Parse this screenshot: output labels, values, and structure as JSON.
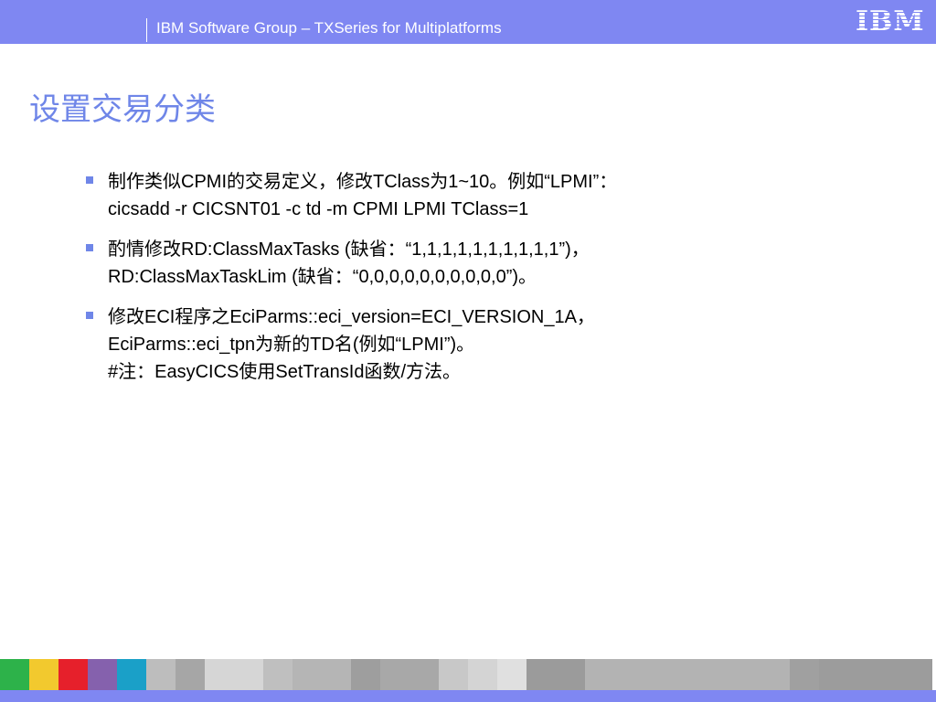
{
  "header": {
    "title": "IBM Software Group – TXSeries for Multiplatforms",
    "logo_text": "IBM"
  },
  "slide": {
    "title": "设置交易分类",
    "bullets": [
      {
        "lines": [
          "制作类似CPMI的交易定义，修改TClass为1~10。例如“LPMI”：",
          "cicsadd -r CICSNT01 -c td -m CPMI LPMI TClass=1"
        ]
      },
      {
        "lines": [
          "酌情修改RD:ClassMaxTasks (缺省：“1,1,1,1,1,1,1,1,1,1”)，",
          "RD:ClassMaxTaskLim (缺省：“0,0,0,0,0,0,0,0,0,0”)。"
        ]
      },
      {
        "lines": [
          "修改ECI程序之EciParms::eci_version=ECI_VERSION_1A，",
          "EciParms::eci_tpn为新的TD名(例如“LPMI”)。",
          "#注：EasyCICS使用SetTransId函数/方法。"
        ]
      }
    ]
  },
  "colors": {
    "header_bar": "#7f87f2",
    "title": "#6f86e8",
    "bullet_marker": "#6f86e8",
    "body_text": "#000000"
  },
  "footer": {
    "tiles": [
      {
        "color": "#2db24a",
        "pattern": "solid"
      },
      {
        "color": "#f2c92e",
        "pattern": "solid"
      },
      {
        "color": "#e6202b",
        "pattern": "solid"
      },
      {
        "color": "#8561ad",
        "pattern": "solid"
      },
      {
        "color": "#1aa0c8",
        "pattern": "solid"
      },
      {
        "color": "#bdbdbd",
        "pattern": "photo"
      },
      {
        "color": "#a6a6a6",
        "pattern": "circle"
      },
      {
        "color": "#d6d6d6",
        "pattern": "grid"
      },
      {
        "color": "#bfbfbf",
        "pattern": "stripes"
      },
      {
        "color": "#b5b5b5",
        "pattern": "photo"
      },
      {
        "color": "#9e9e9e",
        "pattern": "solid"
      },
      {
        "color": "#a8a8a8",
        "pattern": "starburst"
      },
      {
        "color": "#c8c8c8",
        "pattern": "lines"
      },
      {
        "color": "#d4d4d4",
        "pattern": "solid"
      },
      {
        "color": "#e0e0e0",
        "pattern": "checker"
      },
      {
        "color": "#9b9b9b",
        "pattern": "solid"
      },
      {
        "color": "#b3b3b3",
        "pattern": "solid"
      },
      {
        "color": "#a0a0a0",
        "pattern": "solid"
      },
      {
        "color": "#9c9c9c",
        "pattern": "solid"
      }
    ]
  }
}
